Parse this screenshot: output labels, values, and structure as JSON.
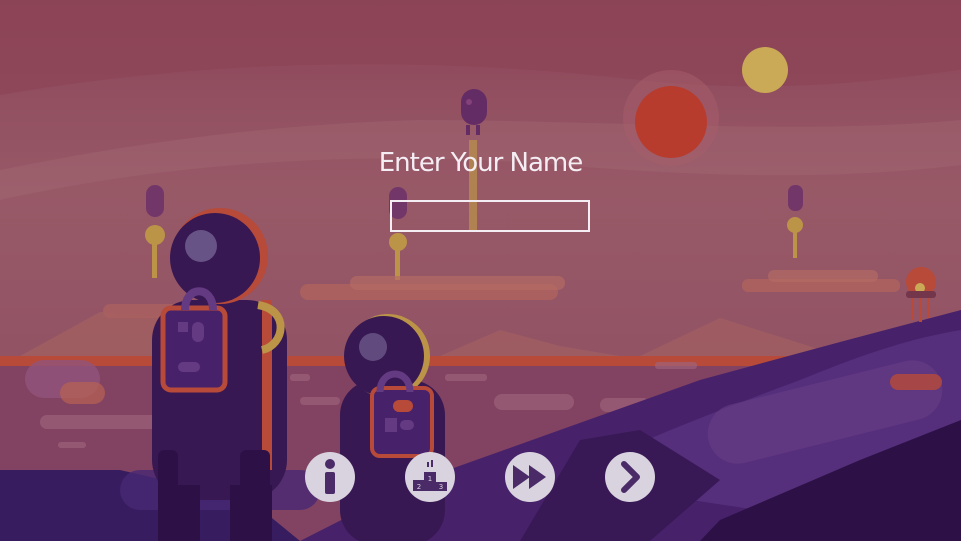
{
  "dialog": {
    "title": "Enter Your Name",
    "name_value": "",
    "name_placeholder": ""
  },
  "buttons": [
    {
      "id": "info",
      "icon": "info-icon"
    },
    {
      "id": "leaderboard",
      "icon": "podium-icon",
      "podium_places": [
        "1",
        "2",
        "3"
      ]
    },
    {
      "id": "fast-forward",
      "icon": "fast-forward-icon"
    },
    {
      "id": "next",
      "icon": "chevron-right-icon"
    }
  ],
  "colors": {
    "sky_top": "#974c5e",
    "sky_mid": "#a86a76",
    "ground": "#8a4a6a",
    "hills_dark": "#3a1a55",
    "text": "#f4eef4",
    "button_bg": "#d9d3df",
    "button_icon": "#4a2b68",
    "sun": "#c4402e",
    "moon": "#d8b85a"
  }
}
